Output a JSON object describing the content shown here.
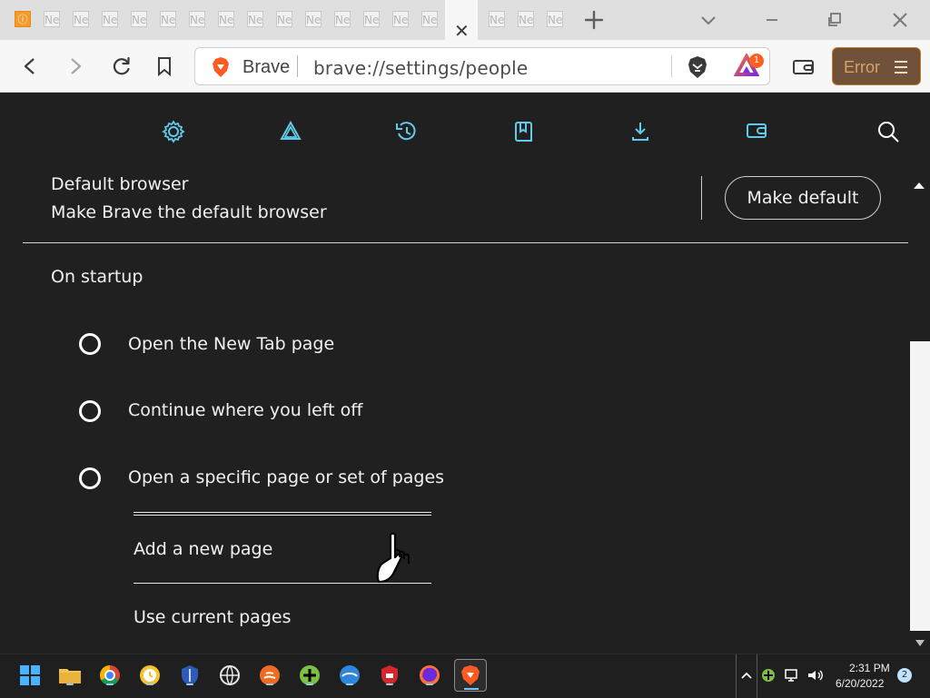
{
  "browser": {
    "brand": "Brave",
    "url": "brave://settings/people",
    "error_label": "Error",
    "tab_placeholder": "Ne",
    "window_controls": [
      "minimize-icon",
      "maximize-icon",
      "close-icon"
    ]
  },
  "settings": {
    "default_browser": {
      "title": "Default browser",
      "subtitle": "Make Brave the default browser",
      "button": "Make default"
    },
    "startup": {
      "title": "On startup",
      "options": [
        {
          "label": "Open the New Tab page"
        },
        {
          "label": "Continue where you left off"
        },
        {
          "label": "Open a specific page or set of pages"
        }
      ],
      "subsection": {
        "add_page": "Add a new page",
        "use_current": "Use current pages"
      }
    }
  },
  "rewards": {
    "badge": "1"
  },
  "taskbar": {
    "time": "2:31 PM",
    "date": "6/20/2022",
    "notifications": "2"
  }
}
